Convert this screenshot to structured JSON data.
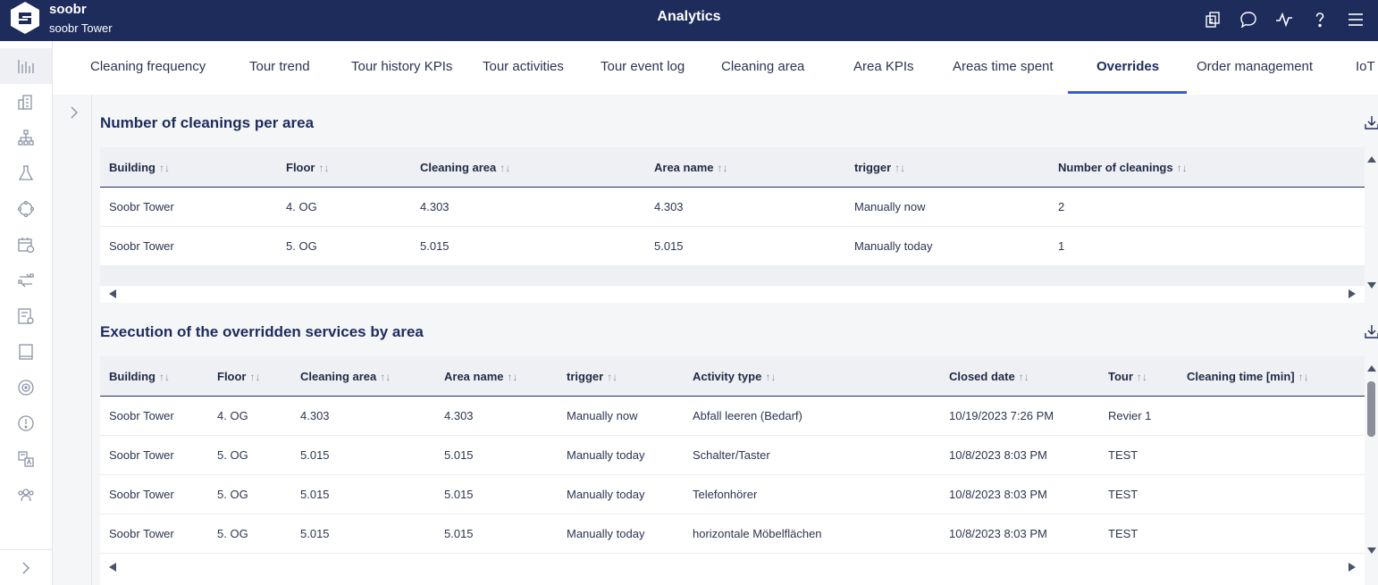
{
  "header": {
    "brand": "soobr",
    "building": "soobr Tower",
    "title": "Analytics",
    "icons": [
      "switch-building-icon",
      "chat-icon",
      "activity-icon",
      "help-icon",
      "menu-icon"
    ]
  },
  "sidebar": {
    "items": [
      "analytics-icon",
      "buildings-icon",
      "hierarchy-icon",
      "lab-icon",
      "cycle-icon",
      "calendar-icon",
      "transfer-icon",
      "report-icon",
      "book-icon",
      "target-icon",
      "alert-icon",
      "translate-icon",
      "team-icon"
    ],
    "active": "analytics-icon",
    "expand_icon": "chevron-right-icon"
  },
  "tabs": [
    "Cleaning frequency",
    "Tour trend",
    "Tour history KPIs",
    "Tour activities",
    "Tour event log",
    "Cleaning area",
    "Area KPIs",
    "Areas time spent",
    "Overrides",
    "Order management",
    "IoT"
  ],
  "active_tab": "Overrides",
  "panel1": {
    "title": "Number of cleanings per area",
    "headers": [
      "Building",
      "Floor",
      "Cleaning area",
      "Area name",
      "trigger",
      "Number of cleanings"
    ],
    "rows": [
      [
        "Soobr Tower",
        "4. OG",
        "4.303",
        "4.303",
        "Manually now",
        "2"
      ],
      [
        "Soobr Tower",
        "5. OG",
        "5.015",
        "5.015",
        "Manually today",
        "1"
      ]
    ]
  },
  "panel2": {
    "title": "Execution of the overridden services by area",
    "headers": [
      "Building",
      "Floor",
      "Cleaning area",
      "Area name",
      "trigger",
      "Activity type",
      "Closed date",
      "Tour",
      "Cleaning time [min]"
    ],
    "rows": [
      [
        "Soobr Tower",
        "4. OG",
        "4.303",
        "4.303",
        "Manually now",
        "Abfall leeren (Bedarf)",
        "10/19/2023 7:26 PM",
        "Revier 1",
        ""
      ],
      [
        "Soobr Tower",
        "5. OG",
        "5.015",
        "5.015",
        "Manually today",
        "Schalter/Taster",
        "10/8/2023 8:03 PM",
        "TEST",
        ""
      ],
      [
        "Soobr Tower",
        "5. OG",
        "5.015",
        "5.015",
        "Manually today",
        "Telefonhörer",
        "10/8/2023 8:03 PM",
        "TEST",
        ""
      ],
      [
        "Soobr Tower",
        "5. OG",
        "5.015",
        "5.015",
        "Manually today",
        "horizontale Möbelflächen",
        "10/8/2023 8:03 PM",
        "TEST",
        ""
      ]
    ]
  },
  "sort_icon": "↑↓",
  "colors": {
    "header_bg": "#1e2c5c",
    "accent": "#3a5bd9",
    "table_header_bg": "#eef0f4"
  }
}
